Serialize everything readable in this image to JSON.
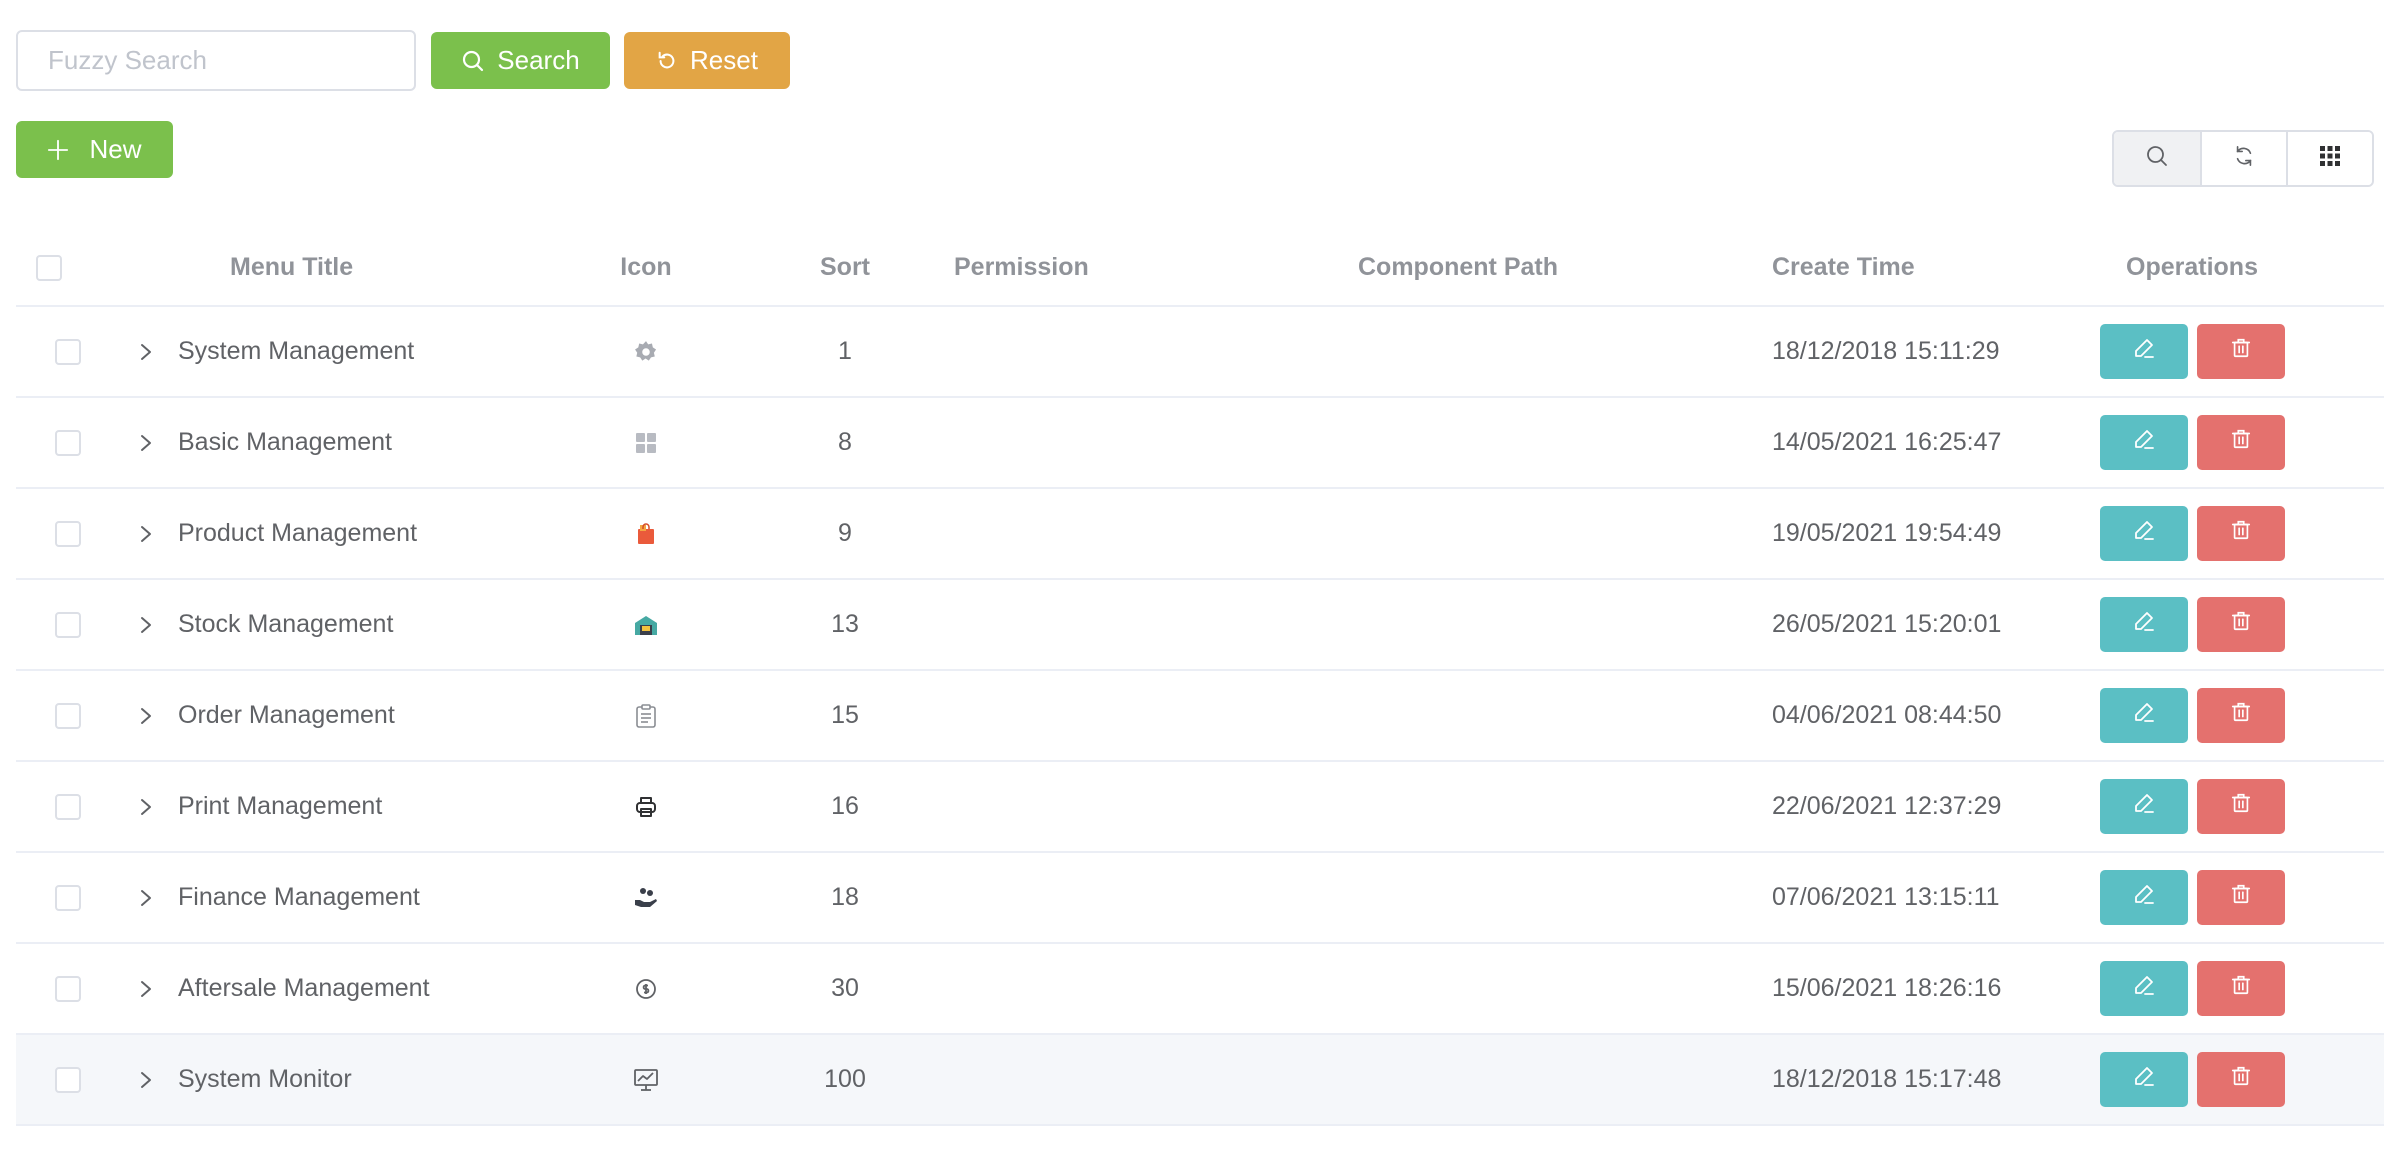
{
  "search": {
    "placeholder": "Fuzzy Search",
    "search_label": "Search",
    "reset_label": "Reset",
    "new_label": "New"
  },
  "table": {
    "headers": {
      "title": "Menu Title",
      "icon": "Icon",
      "sort": "Sort",
      "permission": "Permission",
      "component": "Component Path",
      "created": "Create Time",
      "ops": "Operations"
    },
    "rows": [
      {
        "title": "System Management",
        "icon": "gear-icon",
        "sort": "1",
        "permission": "",
        "component": "",
        "created": "18/12/2018 15:11:29"
      },
      {
        "title": "Basic Management",
        "icon": "grid-icon",
        "sort": "8",
        "permission": "",
        "component": "",
        "created": "14/05/2021 16:25:47"
      },
      {
        "title": "Product Management",
        "icon": "shopping-bag-icon",
        "sort": "9",
        "permission": "",
        "component": "",
        "created": "19/05/2021 19:54:49"
      },
      {
        "title": "Stock Management",
        "icon": "warehouse-icon",
        "sort": "13",
        "permission": "",
        "component": "",
        "created": "26/05/2021 15:20:01"
      },
      {
        "title": "Order Management",
        "icon": "clipboard-icon",
        "sort": "15",
        "permission": "",
        "component": "",
        "created": "04/06/2021 08:44:50"
      },
      {
        "title": "Print Management",
        "icon": "printer-icon",
        "sort": "16",
        "permission": "",
        "component": "",
        "created": "22/06/2021 12:37:29"
      },
      {
        "title": "Finance Management",
        "icon": "coins-hand-icon",
        "sort": "18",
        "permission": "",
        "component": "",
        "created": "07/06/2021 13:15:11"
      },
      {
        "title": "Aftersale Management",
        "icon": "service-coin-icon",
        "sort": "30",
        "permission": "",
        "component": "",
        "created": "15/06/2021 18:26:16"
      },
      {
        "title": "System Monitor",
        "icon": "monitor-chart-icon",
        "sort": "100",
        "permission": "",
        "component": "",
        "created": "18/12/2018 15:17:48"
      }
    ]
  },
  "colors": {
    "primary_green": "#7bc04c",
    "warning_orange": "#e2a545",
    "edit_teal": "#5bbfc4",
    "delete_red": "#e4716e"
  }
}
